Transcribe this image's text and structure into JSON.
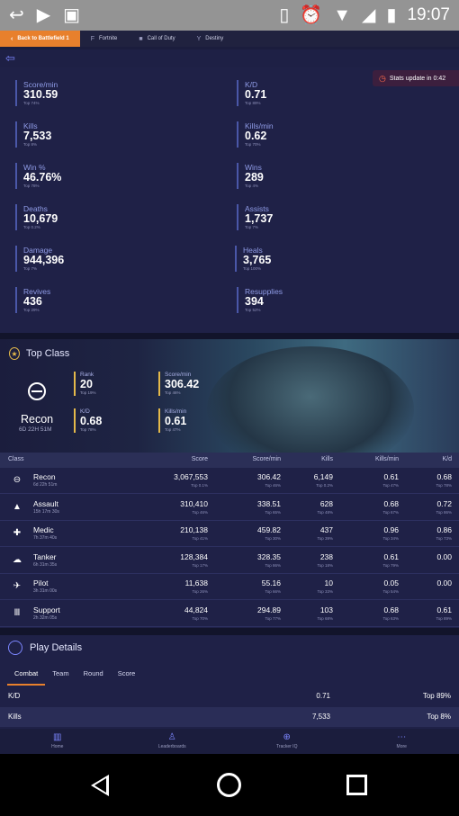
{
  "status_bar": {
    "time": "19:07",
    "left_icons": [
      "reply-icon",
      "youtube-icon",
      "image-icon"
    ],
    "right_icons": [
      "vibrate-icon",
      "alarm-icon",
      "wifi-icon",
      "signal-icon",
      "battery-icon"
    ]
  },
  "game_tabs": [
    {
      "label": "Back to Battlefield 1",
      "icon": "back-icon",
      "active": true
    },
    {
      "label": "Fortnite",
      "icon": "fortnite-icon",
      "active": false
    },
    {
      "label": "Call of Duty",
      "icon": "cod-icon",
      "active": false
    },
    {
      "label": "Destiny",
      "icon": "destiny-icon",
      "active": false
    }
  ],
  "stats_badge": "Stats update in 0:42",
  "stats": [
    {
      "label": "Score/min",
      "value": "310.59",
      "rank": "Top 74%"
    },
    {
      "label": "K/D",
      "value": "0.71",
      "rank": "Top 89%"
    },
    {
      "label": "Kills",
      "value": "7,533",
      "rank": "Top 8%"
    },
    {
      "label": "Kills/min",
      "value": "0.62",
      "rank": "Top 70%"
    },
    {
      "label": "Win %",
      "value": "46.76%",
      "rank": "Top 78%"
    },
    {
      "label": "Wins",
      "value": "289",
      "rank": "Top 4%"
    },
    {
      "label": "Deaths",
      "value": "10,679",
      "rank": "Top 0.2%"
    },
    {
      "label": "Assists",
      "value": "1,737",
      "rank": "Top 7%"
    },
    {
      "label": "Damage",
      "value": "944,396",
      "rank": "Top 7%"
    },
    {
      "label": "Heals",
      "value": "3,765",
      "rank": "Top 100%"
    },
    {
      "label": "Revives",
      "value": "436",
      "rank": "Top 29%"
    },
    {
      "label": "Resupplies",
      "value": "394",
      "rank": "Top 52%"
    }
  ],
  "top_class": {
    "title": "Top Class",
    "name": "Recon",
    "time": "6D 22H 51M",
    "stats": [
      {
        "label": "Rank",
        "value": "20",
        "rank": "Top 19%"
      },
      {
        "label": "Score/min",
        "value": "306.42",
        "rank": "Top 46%"
      },
      {
        "label": "K/D",
        "value": "0.68",
        "rank": "Top 78%"
      },
      {
        "label": "Kills/min",
        "value": "0.61",
        "rank": "Top 47%"
      }
    ]
  },
  "class_table": {
    "headers": [
      "Class",
      "Score",
      "Score/min",
      "Kills",
      "Kills/min",
      "K/d"
    ],
    "rows": [
      {
        "icon": "recon-icon",
        "glyph": "⊖",
        "name": "Recon",
        "time": "6d 22h 51m",
        "cells": [
          {
            "v": "3,067,553",
            "r": "Top 0.1%"
          },
          {
            "v": "306.42",
            "r": "Top 46%"
          },
          {
            "v": "6,149",
            "r": "Top 0.2%"
          },
          {
            "v": "0.61",
            "r": "Top 47%"
          },
          {
            "v": "0.68",
            "r": "Top 78%"
          }
        ]
      },
      {
        "icon": "assault-icon",
        "glyph": "▲",
        "name": "Assault",
        "time": "15h 17m 30s",
        "cells": [
          {
            "v": "310,410",
            "r": "Top 46%"
          },
          {
            "v": "338.51",
            "r": "Top 65%"
          },
          {
            "v": "628",
            "r": "Top 48%"
          },
          {
            "v": "0.68",
            "r": "Top 67%"
          },
          {
            "v": "0.72",
            "r": "Top 86%"
          }
        ]
      },
      {
        "icon": "medic-icon",
        "glyph": "✚",
        "name": "Medic",
        "time": "7h 37m 40s",
        "cells": [
          {
            "v": "210,138",
            "r": "Top 41%"
          },
          {
            "v": "459.82",
            "r": "Top 30%"
          },
          {
            "v": "437",
            "r": "Top 39%"
          },
          {
            "v": "0.96",
            "r": "Top 34%"
          },
          {
            "v": "0.86",
            "r": "Top 73%"
          }
        ]
      },
      {
        "icon": "tanker-icon",
        "glyph": "☁",
        "name": "Tanker",
        "time": "6h 31m 35s",
        "cells": [
          {
            "v": "128,384",
            "r": "Top 17%"
          },
          {
            "v": "328.35",
            "r": "Top 86%"
          },
          {
            "v": "238",
            "r": "Top 18%"
          },
          {
            "v": "0.61",
            "r": "Top 79%"
          },
          {
            "v": "0.00",
            "r": ""
          }
        ]
      },
      {
        "icon": "pilot-icon",
        "glyph": "✈",
        "name": "Pilot",
        "time": "3h 31m 00s",
        "cells": [
          {
            "v": "11,638",
            "r": "Top 26%"
          },
          {
            "v": "55.16",
            "r": "Top 66%"
          },
          {
            "v": "10",
            "r": "Top 33%"
          },
          {
            "v": "0.05",
            "r": "Top 54%"
          },
          {
            "v": "0.00",
            "r": ""
          }
        ]
      },
      {
        "icon": "support-icon",
        "glyph": "Ⅲ",
        "name": "Support",
        "time": "2h 32m 05s",
        "cells": [
          {
            "v": "44,824",
            "r": "Top 70%"
          },
          {
            "v": "294.89",
            "r": "Top 77%"
          },
          {
            "v": "103",
            "r": "Top 68%"
          },
          {
            "v": "0.68",
            "r": "Top 63%"
          },
          {
            "v": "0.61",
            "r": "Top 89%"
          }
        ]
      }
    ]
  },
  "play_details": {
    "title": "Play Details",
    "tabs": [
      "Combat",
      "Team",
      "Round",
      "Score"
    ],
    "rows": [
      {
        "label": "K/D",
        "value": "0.71",
        "rank": "Top 89%"
      },
      {
        "label": "Kills",
        "value": "7,533",
        "rank": "Top 8%"
      }
    ]
  },
  "bottom_nav": [
    {
      "label": "Home",
      "icon": "home-icon"
    },
    {
      "label": "Leaderboards",
      "icon": "leaderboards-icon"
    },
    {
      "label": "Tracker IQ",
      "icon": "tracker-iq-icon"
    },
    {
      "label": "More",
      "icon": "more-icon"
    }
  ]
}
